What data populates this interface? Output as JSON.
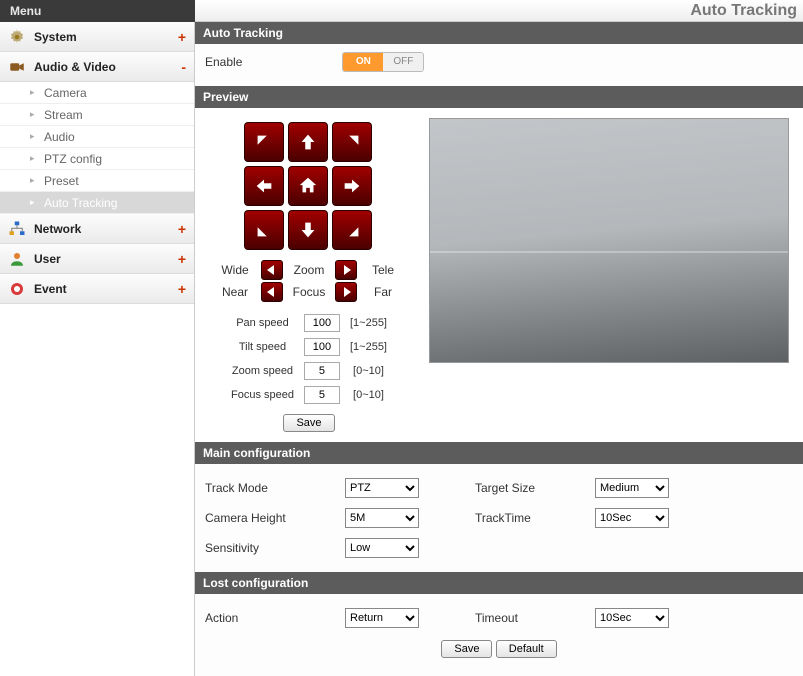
{
  "topbar": {
    "menu": "Menu",
    "title": "Auto Tracking"
  },
  "sidebar": {
    "cats": [
      {
        "label": "System",
        "expanded": false,
        "sign": "+"
      },
      {
        "label": "Audio & Video",
        "expanded": true,
        "sign": "-"
      },
      {
        "label": "Network",
        "expanded": false,
        "sign": "+"
      },
      {
        "label": "User",
        "expanded": false,
        "sign": "+"
      },
      {
        "label": "Event",
        "expanded": false,
        "sign": "+"
      }
    ],
    "av_subs": [
      "Camera",
      "Stream",
      "Audio",
      "PTZ config",
      "Preset",
      "Auto Tracking"
    ],
    "active_sub": "Auto Tracking"
  },
  "sections": {
    "page_hdr": "Auto Tracking",
    "enable_lbl": "Enable",
    "toggle": {
      "on": "ON",
      "off": "OFF",
      "value": "ON"
    },
    "preview_hdr": "Preview",
    "main_hdr": "Main configuration",
    "lost_hdr": "Lost configuration"
  },
  "ptz": {
    "wide": "Wide",
    "zoom": "Zoom",
    "tele": "Tele",
    "near": "Near",
    "focus": "Focus",
    "far": "Far",
    "pan_speed_lbl": "Pan speed",
    "pan_speed": "100",
    "pan_range": "[1~255]",
    "tilt_speed_lbl": "Tilt speed",
    "tilt_speed": "100",
    "tilt_range": "[1~255]",
    "zoom_speed_lbl": "Zoom speed",
    "zoom_speed": "5",
    "zoom_range": "[0~10]",
    "focus_speed_lbl": "Focus speed",
    "focus_speed": "5",
    "focus_range": "[0~10]",
    "save": "Save"
  },
  "main_cfg": {
    "track_mode_lbl": "Track Mode",
    "track_mode": "PTZ",
    "target_size_lbl": "Target Size",
    "target_size": "Medium",
    "camera_height_lbl": "Camera Height",
    "camera_height": "5M",
    "track_time_lbl": "TrackTime",
    "track_time": "10Sec",
    "sensitivity_lbl": "Sensitivity",
    "sensitivity": "Low"
  },
  "lost_cfg": {
    "action_lbl": "Action",
    "action": "Return",
    "timeout_lbl": "Timeout",
    "timeout": "10Sec",
    "save": "Save",
    "default": "Default"
  }
}
